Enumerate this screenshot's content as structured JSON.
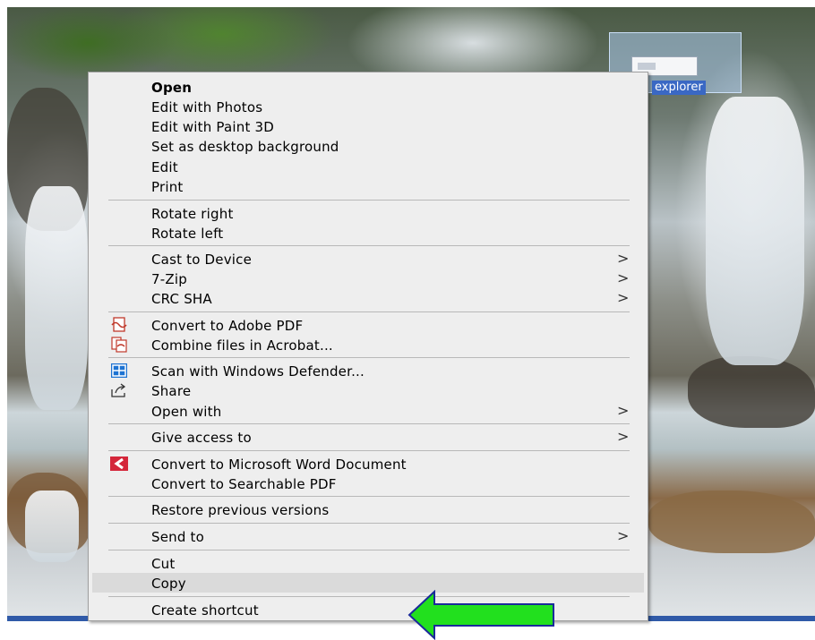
{
  "desktop": {
    "icon_label": "explorer"
  },
  "menu": {
    "items": [
      {
        "label": "Open",
        "bold": true,
        "submenu": false
      },
      {
        "label": "Edit with Photos",
        "submenu": false
      },
      {
        "label": "Edit with Paint 3D",
        "submenu": false
      },
      {
        "label": "Set as desktop background",
        "submenu": false
      },
      {
        "label": "Edit",
        "submenu": false
      },
      {
        "label": "Print",
        "submenu": false
      },
      {
        "label": "Rotate right",
        "submenu": false
      },
      {
        "label": "Rotate left",
        "submenu": false
      },
      {
        "label": "Cast to Device",
        "submenu": true
      },
      {
        "label": "7-Zip",
        "submenu": true
      },
      {
        "label": "CRC SHA",
        "submenu": true
      },
      {
        "label": "Convert to Adobe PDF",
        "icon": "adobe-pdf-icon",
        "submenu": false
      },
      {
        "label": "Combine files in Acrobat...",
        "icon": "acrobat-combine-icon",
        "submenu": false
      },
      {
        "label": "Scan with Windows Defender...",
        "icon": "windows-defender-icon",
        "submenu": false
      },
      {
        "label": "Share",
        "icon": "share-icon",
        "submenu": false
      },
      {
        "label": "Open with",
        "submenu": true
      },
      {
        "label": "Give access to",
        "submenu": true
      },
      {
        "label": "Convert to Microsoft Word Document",
        "icon": "word-convert-icon",
        "submenu": false
      },
      {
        "label": "Convert to Searchable PDF",
        "submenu": false
      },
      {
        "label": "Restore previous versions",
        "submenu": false
      },
      {
        "label": "Send to",
        "submenu": true
      },
      {
        "label": "Cut",
        "submenu": false
      },
      {
        "label": "Copy",
        "submenu": false,
        "highlighted": true
      },
      {
        "label": "Create shortcut",
        "submenu": false
      }
    ],
    "submenu_arrow": ">"
  },
  "annotation": {
    "arrow_color": "#22e01e",
    "arrow_outline": "#1a2a9a"
  }
}
